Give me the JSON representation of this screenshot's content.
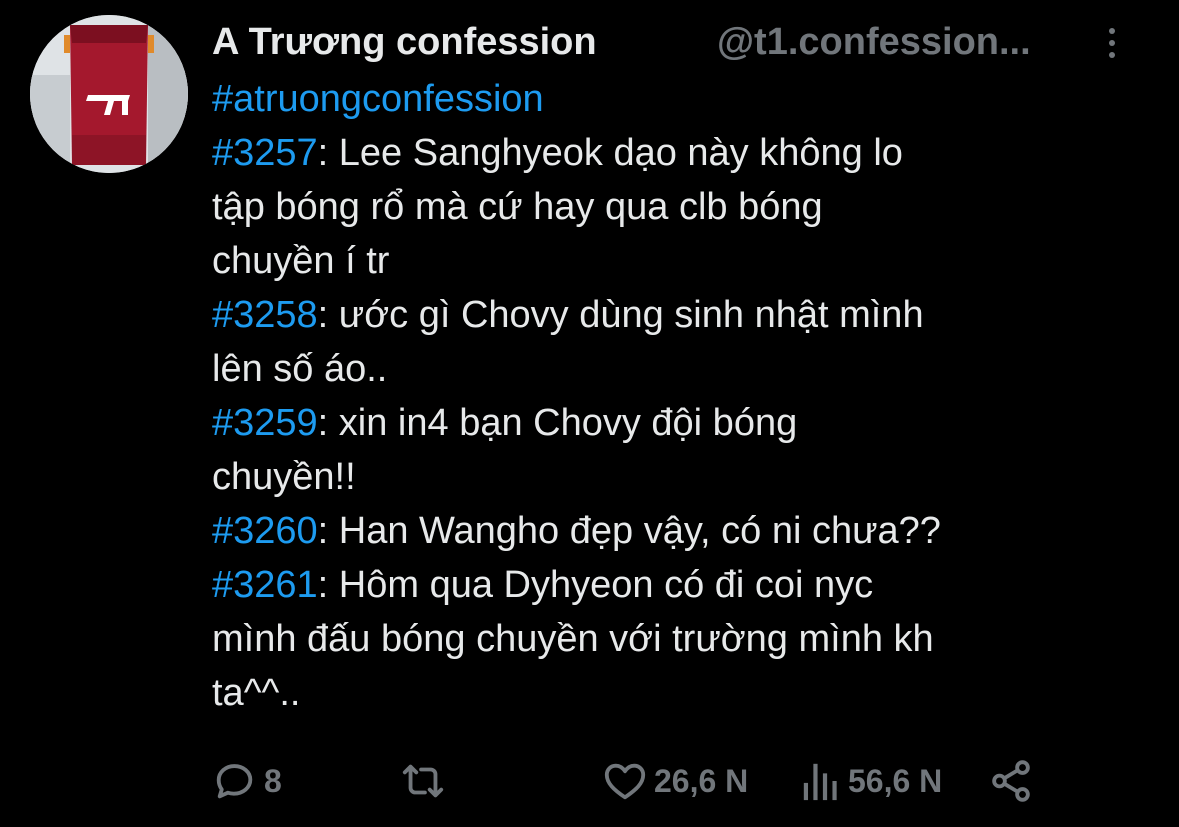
{
  "author": {
    "display_name": "A Trương confession",
    "handle": "@t1.confession...",
    "avatar_icon": "avatar-image"
  },
  "tweet": {
    "lines": [
      {
        "parts": [
          {
            "type": "tag",
            "text": "#atruongconfession"
          }
        ]
      },
      {
        "parts": [
          {
            "type": "num",
            "text": "#3257"
          },
          {
            "type": "text",
            "text": ": Lee Sanghyeok dạo này không lo"
          }
        ]
      },
      {
        "parts": [
          {
            "type": "text",
            "text": "tập bóng rổ mà cứ hay qua clb bóng"
          }
        ]
      },
      {
        "parts": [
          {
            "type": "text",
            "text": "chuyền í tr"
          }
        ]
      },
      {
        "parts": [
          {
            "type": "num",
            "text": "#3258"
          },
          {
            "type": "text",
            "text": ": ước gì Chovy dùng sinh nhật mình"
          }
        ]
      },
      {
        "parts": [
          {
            "type": "text",
            "text": "lên số áo.."
          }
        ]
      },
      {
        "parts": [
          {
            "type": "num",
            "text": "#3259"
          },
          {
            "type": "text",
            "text": ": xin in4 bạn Chovy đội bóng"
          }
        ]
      },
      {
        "parts": [
          {
            "type": "text",
            "text": "chuyền!!"
          }
        ]
      },
      {
        "parts": [
          {
            "type": "num",
            "text": "#3260"
          },
          {
            "type": "text",
            "text": ": Han Wangho đẹp vậy, có ni chưa??"
          }
        ]
      },
      {
        "parts": [
          {
            "type": "num",
            "text": "#3261"
          },
          {
            "type": "text",
            "text": ": Hôm qua Dyhyeon có đi coi nyc"
          }
        ]
      },
      {
        "parts": [
          {
            "type": "text",
            "text": "mình đấu bóng chuyền với trường mình kh"
          }
        ]
      },
      {
        "parts": [
          {
            "type": "text",
            "text": "ta^^.."
          }
        ]
      }
    ]
  },
  "actions": {
    "reply": {
      "icon": "reply-icon",
      "count": "8"
    },
    "retweet": {
      "icon": "retweet-icon",
      "count": ""
    },
    "like": {
      "icon": "heart-icon",
      "count": "26,6 N"
    },
    "views": {
      "icon": "views-icon",
      "count": "56,6 N"
    },
    "share": {
      "icon": "share-icon"
    }
  },
  "colors": {
    "background": "#000000",
    "text": "#e7e9ea",
    "muted": "#71767b",
    "link": "#1d9bf0"
  }
}
